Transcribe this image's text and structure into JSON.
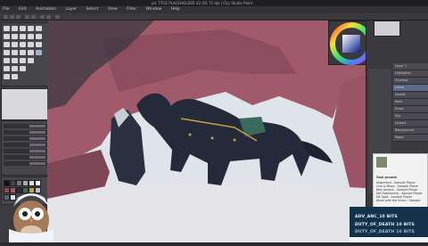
{
  "app": {
    "title_text": "pic TITLE PLACEHOLDER 42.4% 72 dpi | Clip Studio Paint",
    "colors": {
      "bg": "#2a2a2e",
      "panel": "#3c3c40",
      "accent": "#5b6b8a",
      "canvas_sky": "#dfe3ea",
      "rock": "#a15a6a",
      "horse": "#252a3b"
    }
  },
  "menu": {
    "items": [
      "File",
      "Edit",
      "Animation",
      "Layer",
      "Select",
      "View",
      "Filter",
      "Window",
      "Help"
    ]
  },
  "right_panel": {
    "layers": [
      "Layer 1",
      "Highlights",
      "Shading",
      "Horse",
      "Saddle",
      "Rock",
      "Snow",
      "Sky",
      "Lineart",
      "Background",
      "Paper"
    ]
  },
  "info_panel": {
    "heading": "Goal ground",
    "lines": [
      "Alignment - Sample Player",
      "Line & Move - Sample Player",
      "Rein stretch - Sample Player",
      "Dot Positioning - Sample Player",
      "Hit Spot - Sample Player",
      "Aksel with the fence - Sample"
    ]
  },
  "stream_goals": {
    "goal1": "ADV_ANC_10 BITS",
    "goal2": "DUTY_OF_DEATH 10 BITS",
    "goal3": "DUTY_OF_DEATH 10 BITS"
  }
}
